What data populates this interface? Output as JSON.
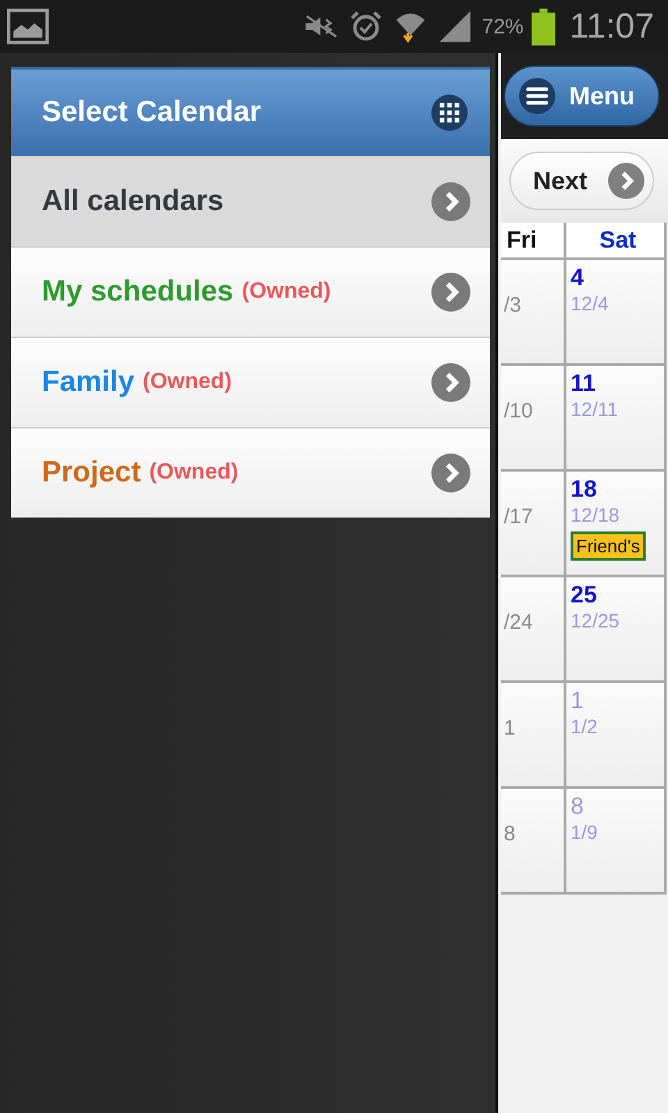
{
  "status_bar": {
    "battery_text": "72%",
    "time": "11:07"
  },
  "header": {
    "menu_button": "Menu"
  },
  "next_button": "Next",
  "calendar": {
    "columns": [
      "Fri",
      "Sat"
    ],
    "rows": [
      {
        "fri_date": "/3",
        "sat": {
          "day": "4",
          "date": "12/4",
          "muted": false
        }
      },
      {
        "fri_date": "/10",
        "sat": {
          "day": "11",
          "date": "12/11",
          "muted": false
        }
      },
      {
        "fri_date": "/17",
        "sat": {
          "day": "18",
          "date": "12/18",
          "muted": false,
          "event": {
            "label": "Friend's",
            "color": "#f7c21a"
          }
        }
      },
      {
        "fri_date": "/24",
        "sat": {
          "day": "25",
          "date": "12/25",
          "muted": false
        }
      },
      {
        "fri_date": "1",
        "sat": {
          "day": "1",
          "date": "1/2",
          "muted": true
        }
      },
      {
        "fri_date": "8",
        "sat": {
          "day": "8",
          "date": "1/9",
          "muted": true
        }
      }
    ]
  },
  "drawer": {
    "title": "Select Calendar",
    "items": [
      {
        "label": "All calendars",
        "selected": true,
        "color": "#333a40"
      },
      {
        "label": "My schedules",
        "badge": "(Owned)",
        "selected": false,
        "color": "#2f9a2f"
      },
      {
        "label": "Family",
        "badge": "(Owned)",
        "selected": false,
        "color": "#1c86e6"
      },
      {
        "label": "Project",
        "badge": "(Owned)",
        "selected": false,
        "color": "#cf6a1c"
      }
    ]
  }
}
